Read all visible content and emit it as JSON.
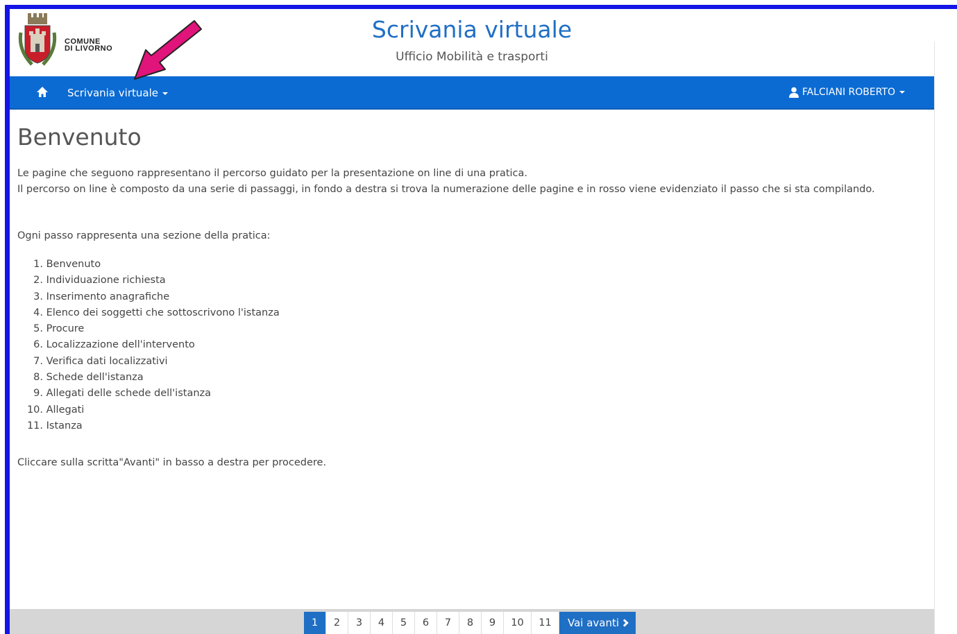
{
  "header": {
    "logo_line1": "COMUNE",
    "logo_line2": "DI LIVORNO",
    "title": "Scrivania virtuale",
    "subtitle": "Ufficio Mobilità e trasporti"
  },
  "navbar": {
    "home_icon": "home-icon",
    "menu_label": "Scrivania virtuale",
    "user_icon": "user-icon",
    "user_label": "FALCIANI ROBERTO"
  },
  "main": {
    "title": "Benvenuto",
    "intro_line1": "Le pagine che seguono rappresentano il percorso guidato per la presentazione on line di una pratica.",
    "intro_line2": "Il percorso on line è composto da una serie di passaggi, in fondo a destra si trova la numerazione delle pagine e in rosso viene evidenziato il passo che si sta compilando.",
    "lead": "Ogni passo rappresenta una sezione della pratica:",
    "steps": [
      {
        "num": "1.",
        "label": "Benvenuto"
      },
      {
        "num": "2.",
        "label": "Individuazione richiesta"
      },
      {
        "num": "3.",
        "label": "Inserimento anagrafiche"
      },
      {
        "num": "4.",
        "label": "Elenco dei soggetti che sottoscrivono l'istanza"
      },
      {
        "num": "5.",
        "label": "Procure"
      },
      {
        "num": "6.",
        "label": "Localizzazione dell'intervento"
      },
      {
        "num": "7.",
        "label": "Verifica dati localizzativi"
      },
      {
        "num": "8.",
        "label": "Schede dell'istanza"
      },
      {
        "num": "9.",
        "label": "Allegati delle schede dell'istanza"
      },
      {
        "num": "10.",
        "label": "Allegati"
      },
      {
        "num": "11.",
        "label": "Istanza"
      }
    ],
    "outro": "Cliccare sulla scritta\"Avanti\" in basso a destra per procedere."
  },
  "pager": {
    "pages": [
      "1",
      "2",
      "3",
      "4",
      "5",
      "6",
      "7",
      "8",
      "9",
      "10",
      "11"
    ],
    "active": "1",
    "next_label": "Vai avanti"
  },
  "colors": {
    "frame": "#1414e6",
    "navbar": "#0b6bd3",
    "title": "#1f6fc5",
    "annotation_arrow": "#e0147a"
  }
}
